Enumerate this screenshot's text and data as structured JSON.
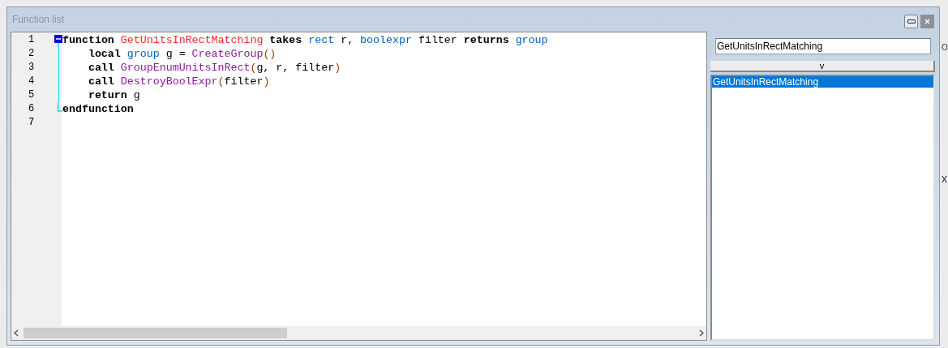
{
  "window": {
    "title": "Function list"
  },
  "editor": {
    "lines": [
      {
        "number": "1",
        "kind": "fold_start",
        "indented": false,
        "tokens": [
          {
            "t": "function ",
            "kind": "keyword"
          },
          {
            "t": "GetUnitsInRectMatching ",
            "kind": "name"
          },
          {
            "t": "takes ",
            "kind": "keyword"
          },
          {
            "t": "rect",
            "kind": "type"
          },
          {
            "t": " r, ",
            "kind": "plain"
          },
          {
            "t": "boolexpr",
            "kind": "type"
          },
          {
            "t": " filter ",
            "kind": "plain"
          },
          {
            "t": "returns ",
            "kind": "keyword"
          },
          {
            "t": "group",
            "kind": "type"
          }
        ]
      },
      {
        "number": "2",
        "kind": "fold_body",
        "indented": true,
        "tokens": [
          {
            "t": "local ",
            "kind": "keyword"
          },
          {
            "t": "group",
            "kind": "type"
          },
          {
            "t": " g = ",
            "kind": "plain"
          },
          {
            "t": "CreateGroup",
            "kind": "native"
          },
          {
            "t": "()",
            "kind": "paren"
          }
        ]
      },
      {
        "number": "3",
        "kind": "fold_body",
        "indented": true,
        "tokens": [
          {
            "t": "call ",
            "kind": "keyword"
          },
          {
            "t": "GroupEnumUnitsInRect",
            "kind": "native"
          },
          {
            "t": "(",
            "kind": "paren"
          },
          {
            "t": "g, r, filter",
            "kind": "plain"
          },
          {
            "t": ")",
            "kind": "paren"
          }
        ]
      },
      {
        "number": "4",
        "kind": "fold_body",
        "indented": true,
        "tokens": [
          {
            "t": "call ",
            "kind": "keyword"
          },
          {
            "t": "DestroyBoolExpr",
            "kind": "native"
          },
          {
            "t": "(",
            "kind": "paren"
          },
          {
            "t": "filter",
            "kind": "plain"
          },
          {
            "t": ")",
            "kind": "paren"
          }
        ]
      },
      {
        "number": "5",
        "kind": "fold_body",
        "indented": true,
        "tokens": [
          {
            "t": "return",
            "kind": "keyword"
          },
          {
            "t": " g",
            "kind": "plain"
          }
        ]
      },
      {
        "number": "6",
        "kind": "fold_end",
        "indented": false,
        "tokens": [
          {
            "t": "endfunction",
            "kind": "keyword"
          }
        ]
      },
      {
        "number": "7",
        "kind": "plain"
      }
    ]
  },
  "search": {
    "value": "GetUnitsInRectMatching"
  },
  "sort_button": {
    "label": "v"
  },
  "function_list": [
    {
      "label": "GetUnitsInRectMatching",
      "selected": true
    }
  ],
  "background_fragments": [
    "O",
    "x"
  ]
}
